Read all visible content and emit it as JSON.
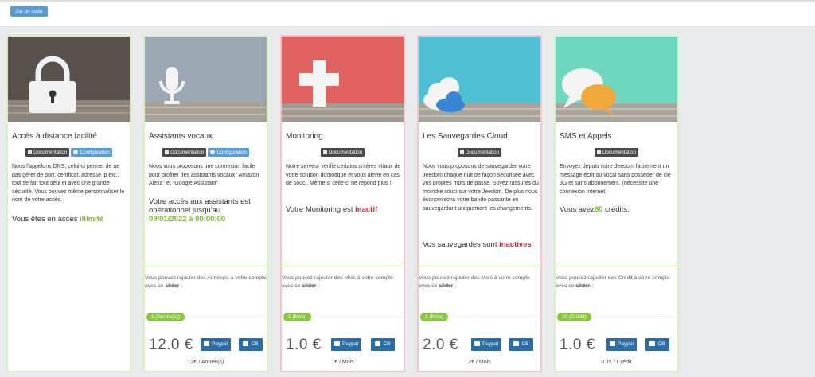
{
  "header": {
    "code_button": "J'ai un code"
  },
  "labels": {
    "documentation": "Documentation",
    "configuration": "Configuration",
    "paypal": "Paypal",
    "cb": "CB"
  },
  "cards": [
    {
      "title": "Accès à distance facilité",
      "image": "lock-icon",
      "has_config": true,
      "description": "Nous l'appelons DNS, celui-ci permet de ne pas gérer de port, certificat, adresse ip etc.. tout se fait tout seul et avec une grande sécurité. Vous pouvez même personnaliser le nom de votre accès.",
      "status_prefix": "Vous êtes en accès ",
      "status_value": "illimité",
      "status_color": "#7dba2f"
    },
    {
      "title": "Assistants vocaux",
      "image": "microphone-icon",
      "has_config": true,
      "description": "Nous vous proposons une connexion facile pour profiter des assistants vocaux \"Amazon Alexa\" et \"Google Assistant\"",
      "status_prefix": "Votre accès aux assistants est opérationnel jusqu'au",
      "status_value": "09/01/2022 à 00:00:00",
      "status_color": "#7dba2f",
      "hint_prefix": "Vous pouvez rajouter des Année(s) à votre compte avec ce ",
      "hint_bold": "slider",
      "hint_suffix": " :",
      "slider_label": "1 (Année(s))",
      "price": "12.0 €",
      "unit": "12€ / Année(s)"
    },
    {
      "title": "Monitoring",
      "image": "plus-cross-icon",
      "has_config": false,
      "description": "Notre serveur vérifie certains critères vitaux de votre solution domotique et vous alerte en cas de souci. Même si celle-ci ne répond plus !",
      "status_prefix": "Votre Monitoring est ",
      "status_value": "inactif",
      "status_color": "#d9282f",
      "hint_prefix": "Vous pouvez rajouter des Mois à votre compte avec ce ",
      "hint_bold": "slider",
      "hint_suffix": " :",
      "slider_label": "1 (Mois)",
      "price": "1.0 €",
      "unit": "1€ / Mois"
    },
    {
      "title": "Les Sauvegardes Cloud",
      "image": "cloud-icon",
      "has_config": false,
      "description": "Nous vous proposons de sauvegarder votre Jeedom chaque nuit de façon sécurisée avec vos propres mots de passe. Soyez rassurés du moindre souci sur votre Jeedom. De plus nous économisons votre bande passante en sauvegardant uniquement les changements.",
      "status_prefix": "Vos sauvegardes sont ",
      "status_value": "inactives",
      "status_color": "#d9282f",
      "hint_prefix": "Vous pouvez rajouter des Mois à votre compte avec ce ",
      "hint_bold": "slider",
      "hint_suffix": " :",
      "slider_label": "1 (Mois)",
      "price": "2.0 €",
      "unit": "2€ / Mois"
    },
    {
      "title": "SMS et Appels",
      "image": "speech-bubbles-icon",
      "has_config": false,
      "description": "Envoyez depuis votre Jeedom facilement un message écrit ou vocal sans posséder de clé 3G et sans abonnement. (nécessite une connexion internet)",
      "status_prefix": "Vous avez",
      "status_value": "60",
      "status_suffix": " crédits.",
      "status_color": "#7dba2f",
      "hint_prefix": "Vous pouvez rajouter des Crédit à votre compte avec ce ",
      "hint_bold": "slider",
      "hint_suffix": " :",
      "slider_label": "10 (Crédit)",
      "price": "1.0 €",
      "unit": "0.1€ / Crédit"
    }
  ]
}
